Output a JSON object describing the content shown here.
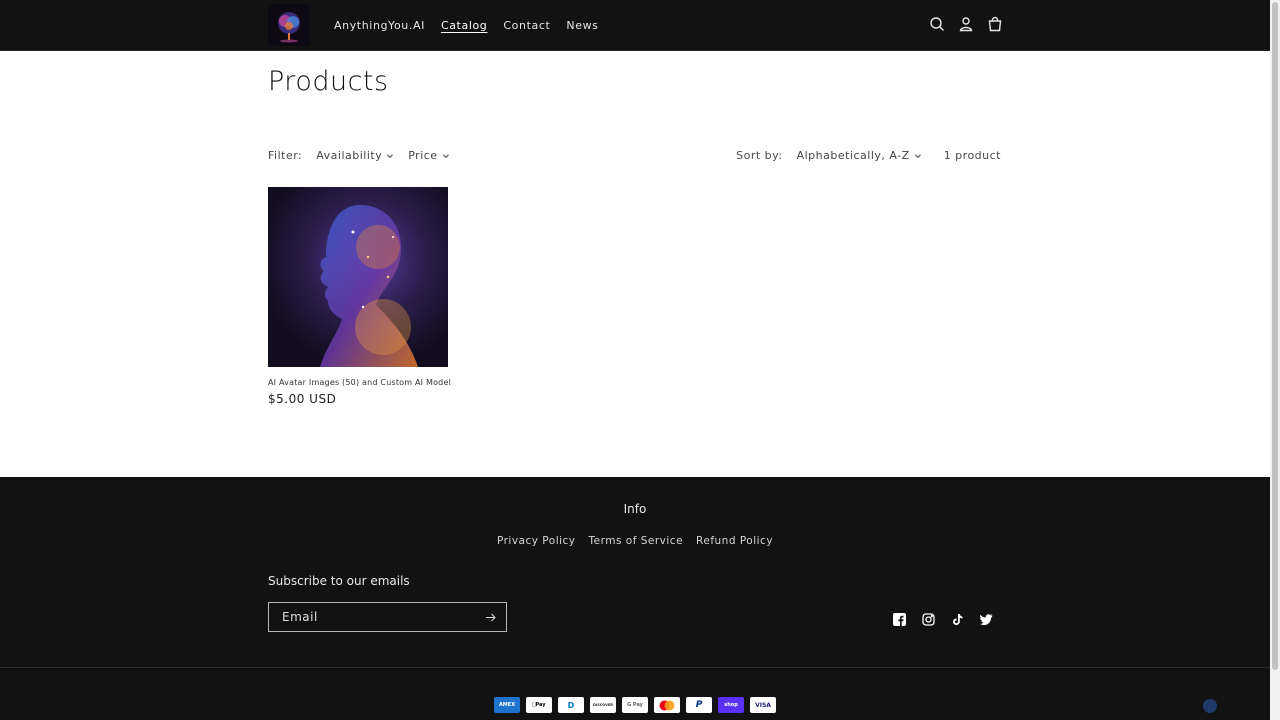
{
  "header": {
    "brand": "AnythingYou.AI",
    "nav": [
      {
        "label": "Catalog",
        "active": true
      },
      {
        "label": "Contact",
        "active": false
      },
      {
        "label": "News",
        "active": false
      }
    ],
    "icons": [
      "search-icon",
      "account-icon",
      "cart-icon"
    ]
  },
  "main": {
    "title": "Products",
    "filter_label": "Filter:",
    "filters": [
      "Availability",
      "Price"
    ],
    "sort_label": "Sort by:",
    "sort_value": "Alphabetically, A-Z",
    "count": "1 product",
    "products": [
      {
        "name": "AI Avatar Images (50) and Custom AI Model",
        "price": "$5.00 USD"
      }
    ]
  },
  "footer": {
    "info_heading": "Info",
    "links": [
      "Privacy Policy",
      "Terms of Service",
      "Refund Policy"
    ],
    "subscribe_heading": "Subscribe to our emails",
    "email_placeholder": "Email",
    "socials": [
      "facebook-icon",
      "instagram-icon",
      "tiktok-icon",
      "twitter-icon"
    ],
    "payments": [
      {
        "name": "American Express",
        "text": "AMEX",
        "bg": "#1f72cd",
        "fg": "#ffffff"
      },
      {
        "name": "Apple Pay",
        "text": "Pay",
        "bg": "#ffffff",
        "fg": "#000000"
      },
      {
        "name": "Diners Club",
        "text": "D",
        "bg": "#ffffff",
        "fg": "#0079be"
      },
      {
        "name": "Discover",
        "text": "DISCOVER",
        "bg": "#ffffff",
        "fg": "#231f20"
      },
      {
        "name": "Google Pay",
        "text": "G Pay",
        "bg": "#ffffff",
        "fg": "#5f6368"
      },
      {
        "name": "Mastercard",
        "text": "",
        "bg": "#ffffff",
        "fg": "#000000"
      },
      {
        "name": "PayPal",
        "text": "P",
        "bg": "#ffffff",
        "fg": "#003087"
      },
      {
        "name": "Shop Pay",
        "text": "shop",
        "bg": "#5a31f4",
        "fg": "#ffffff"
      },
      {
        "name": "Visa",
        "text": "VISA",
        "bg": "#ffffff",
        "fg": "#1a1f71"
      }
    ]
  },
  "colors": {
    "header_bg": "#121212",
    "footer_bg": "#121212",
    "page_bg": "#ffffff"
  }
}
